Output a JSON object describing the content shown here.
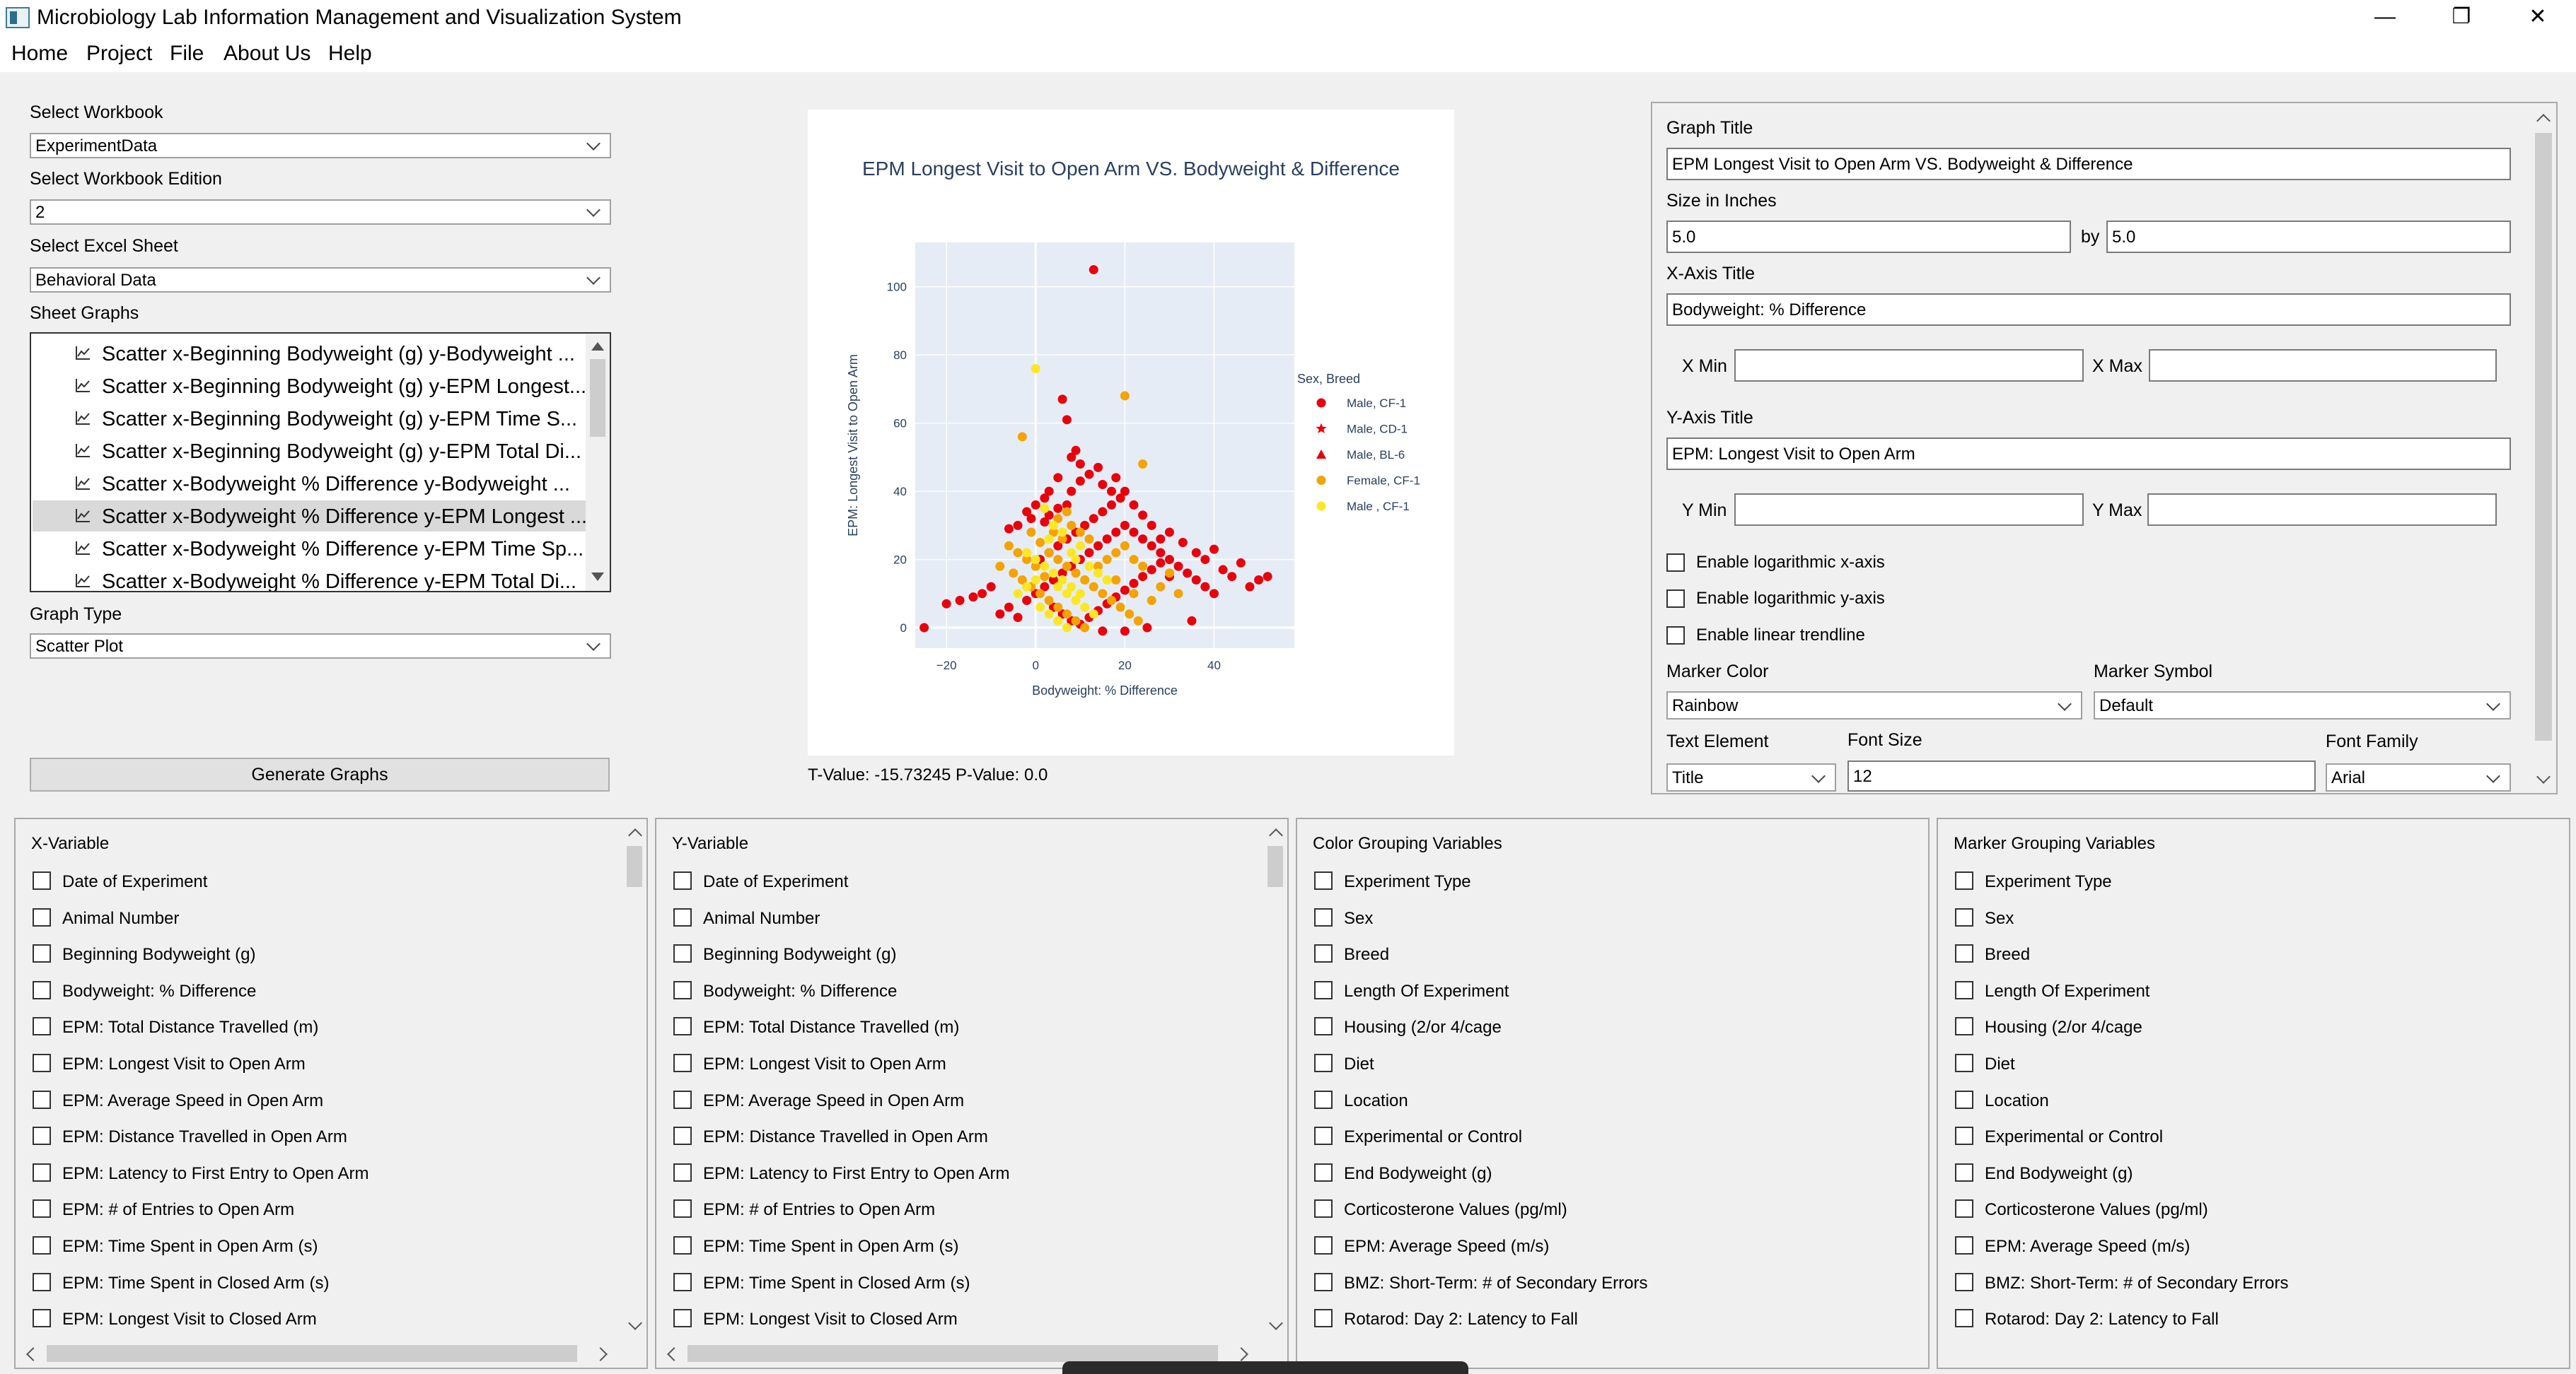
{
  "window": {
    "title": "Microbiology Lab Information Management and Visualization System",
    "minimize": "—",
    "restore": "❐",
    "close": "✕"
  },
  "menu": [
    "Home",
    "Project",
    "File",
    "About Us",
    "Help"
  ],
  "left": {
    "workbook_label": "Select Workbook",
    "workbook_value": "ExperimentData",
    "edition_label": "Select Workbook Edition",
    "edition_value": "2",
    "sheet_label": "Select Excel Sheet",
    "sheet_value": "Behavioral Data",
    "graphs_label": "Sheet Graphs",
    "graphs": [
      "Scatter x-Beginning Bodyweight (g) y-Bodyweight ...",
      "Scatter x-Beginning Bodyweight (g) y-EPM Longest...",
      "Scatter x-Beginning Bodyweight (g) y-EPM Time S...",
      "Scatter x-Beginning Bodyweight (g) y-EPM Total Di...",
      "Scatter x-Bodyweight % Difference y-Bodyweight ...",
      "Scatter x-Bodyweight % Difference y-EPM Longest ...",
      "Scatter x-Bodyweight % Difference y-EPM Time Sp...",
      "Scatter x-Bodyweight % Difference y-EPM Total Di..."
    ],
    "selected_graph_index": 5,
    "graph_type_label": "Graph Type",
    "graph_type_value": "Scatter Plot",
    "generate_button": "Generate Graphs"
  },
  "stats_text": "T-Value: -15.73245  P-Value: 0.0",
  "chart_data": {
    "type": "scatter",
    "title": "EPM Longest Visit to Open Arm VS. Bodyweight & Difference",
    "xlabel": "Bodyweight: % Difference",
    "ylabel": "EPM: Longest Visit to Open Arm",
    "xlim": [
      -27,
      58
    ],
    "ylim": [
      -6,
      113
    ],
    "xticks": [
      -20,
      0,
      20,
      40
    ],
    "xtick_labels": [
      "−20",
      "0",
      "20",
      "40"
    ],
    "yticks": [
      0,
      20,
      40,
      60,
      80,
      100
    ],
    "grid": true,
    "legend_title": "Sex, Breed",
    "legend_position": "right",
    "series": [
      {
        "name": "Male, CF-1",
        "color": "#e8000b",
        "symbol": "circle",
        "points": [
          [
            13,
            105
          ],
          [
            -4,
            30
          ],
          [
            -6,
            29
          ],
          [
            -1,
            32
          ],
          [
            3,
            33
          ],
          [
            2,
            31
          ],
          [
            5,
            35
          ],
          [
            7,
            36
          ],
          [
            8,
            40
          ],
          [
            10,
            43
          ],
          [
            12,
            45
          ],
          [
            14,
            47
          ],
          [
            18,
            44
          ],
          [
            20,
            40
          ],
          [
            22,
            36
          ],
          [
            24,
            33
          ],
          [
            26,
            30
          ],
          [
            28,
            26
          ],
          [
            30,
            28
          ],
          [
            33,
            25
          ],
          [
            36,
            22
          ],
          [
            38,
            20
          ],
          [
            40,
            23
          ],
          [
            42,
            17
          ],
          [
            44,
            15
          ],
          [
            46,
            19
          ],
          [
            48,
            12
          ],
          [
            50,
            14
          ],
          [
            52,
            15
          ],
          [
            -10,
            12
          ],
          [
            -12,
            10
          ],
          [
            -14,
            9
          ],
          [
            -17,
            8
          ],
          [
            -20,
            7
          ],
          [
            -25,
            0
          ],
          [
            -8,
            4
          ],
          [
            -6,
            6
          ],
          [
            -4,
            3
          ],
          [
            -2,
            8
          ],
          [
            0,
            10
          ],
          [
            2,
            12
          ],
          [
            4,
            14
          ],
          [
            6,
            16
          ],
          [
            8,
            18
          ],
          [
            10,
            20
          ],
          [
            12,
            22
          ],
          [
            14,
            24
          ],
          [
            16,
            26
          ],
          [
            18,
            28
          ],
          [
            20,
            30
          ],
          [
            22,
            28
          ],
          [
            24,
            26
          ],
          [
            26,
            24
          ],
          [
            28,
            22
          ],
          [
            30,
            20
          ],
          [
            32,
            18
          ],
          [
            34,
            16
          ],
          [
            36,
            14
          ],
          [
            38,
            12
          ],
          [
            40,
            10
          ],
          [
            4,
            6
          ],
          [
            6,
            4
          ],
          [
            8,
            2
          ],
          [
            10,
            1
          ],
          [
            12,
            3
          ],
          [
            14,
            5
          ],
          [
            16,
            7
          ],
          [
            18,
            9
          ],
          [
            20,
            11
          ],
          [
            22,
            13
          ],
          [
            24,
            15
          ],
          [
            26,
            17
          ],
          [
            28,
            19
          ],
          [
            30,
            15
          ],
          [
            1,
            20
          ],
          [
            3,
            22
          ],
          [
            5,
            24
          ],
          [
            7,
            26
          ],
          [
            9,
            28
          ],
          [
            11,
            30
          ],
          [
            13,
            32
          ],
          [
            15,
            34
          ],
          [
            17,
            36
          ],
          [
            19,
            38
          ],
          [
            6,
            67
          ],
          [
            7,
            61
          ],
          [
            9,
            52
          ],
          [
            8,
            50
          ],
          [
            10,
            48
          ],
          [
            15,
            42
          ],
          [
            17,
            40
          ],
          [
            5,
            44
          ],
          [
            3,
            40
          ],
          [
            2,
            38
          ],
          [
            0,
            36
          ],
          [
            -2,
            34
          ],
          [
            25,
            0
          ],
          [
            35,
            2
          ],
          [
            20,
            -1
          ],
          [
            15,
            -1
          ]
        ]
      },
      {
        "name": "Male, CD-1",
        "color": "#e8000b",
        "symbol": "star",
        "points": []
      },
      {
        "name": "Male, BL-6",
        "color": "#e8000b",
        "symbol": "triangle-up",
        "points": []
      },
      {
        "name": "Female, CF-1",
        "color": "#f5a300",
        "symbol": "circle",
        "points": [
          [
            20,
            68
          ],
          [
            -3,
            56
          ],
          [
            24,
            48
          ],
          [
            -1,
            28
          ],
          [
            1,
            25
          ],
          [
            3,
            22
          ],
          [
            5,
            20
          ],
          [
            7,
            18
          ],
          [
            9,
            16
          ],
          [
            11,
            14
          ],
          [
            13,
            12
          ],
          [
            15,
            10
          ],
          [
            17,
            8
          ],
          [
            19,
            6
          ],
          [
            21,
            4
          ],
          [
            23,
            2
          ],
          [
            -5,
            16
          ],
          [
            -3,
            14
          ],
          [
            -1,
            12
          ],
          [
            1,
            10
          ],
          [
            3,
            8
          ],
          [
            5,
            6
          ],
          [
            7,
            4
          ],
          [
            9,
            2
          ],
          [
            11,
            0
          ],
          [
            14,
            18
          ],
          [
            16,
            20
          ],
          [
            18,
            22
          ],
          [
            20,
            24
          ],
          [
            22,
            20
          ],
          [
            24,
            18
          ],
          [
            12,
            26
          ],
          [
            10,
            28
          ],
          [
            8,
            30
          ],
          [
            6,
            26
          ],
          [
            4,
            28
          ],
          [
            2,
            15
          ],
          [
            0,
            18
          ],
          [
            -2,
            20
          ],
          [
            -4,
            22
          ],
          [
            -6,
            24
          ],
          [
            -8,
            18
          ],
          [
            18,
            14
          ],
          [
            22,
            10
          ],
          [
            26,
            8
          ],
          [
            28,
            12
          ],
          [
            30,
            16
          ],
          [
            32,
            10
          ],
          [
            5,
            32
          ],
          [
            7,
            34
          ]
        ]
      },
      {
        "name": "Male , CF-1",
        "color": "#fde725",
        "symbol": "circle",
        "points": [
          [
            0,
            76
          ],
          [
            2,
            35
          ],
          [
            4,
            30
          ],
          [
            6,
            28
          ],
          [
            -2,
            22
          ],
          [
            0,
            20
          ],
          [
            2,
            18
          ],
          [
            4,
            16
          ],
          [
            6,
            14
          ],
          [
            8,
            12
          ],
          [
            10,
            10
          ],
          [
            1,
            6
          ],
          [
            3,
            4
          ],
          [
            5,
            2
          ],
          [
            7,
            0
          ],
          [
            9,
            8
          ],
          [
            11,
            6
          ],
          [
            13,
            4
          ],
          [
            -4,
            10
          ],
          [
            -2,
            12
          ],
          [
            0,
            14
          ],
          [
            12,
            18
          ],
          [
            14,
            16
          ],
          [
            16,
            14
          ],
          [
            8,
            22
          ],
          [
            10,
            24
          ],
          [
            3,
            26
          ],
          [
            5,
            12
          ],
          [
            7,
            10
          ],
          [
            9,
            20
          ]
        ]
      }
    ]
  },
  "settings": {
    "graph_title_label": "Graph Title",
    "graph_title_value": "EPM Longest Visit to Open Arm VS. Bodyweight & Difference",
    "size_label": "Size in Inches",
    "size_w": "5.0",
    "size_by": "by",
    "size_h": "5.0",
    "xaxis_label": "X-Axis Title",
    "xaxis_value": "Bodyweight: % Difference",
    "xmin_label": "X Min",
    "xmax_label": "X Max",
    "xmin_value": "",
    "xmax_value": "",
    "yaxis_label": "Y-Axis Title",
    "yaxis_value": "EPM: Longest Visit to Open Arm",
    "ymin_label": "Y Min",
    "ymax_label": "Y Max",
    "ymin_value": "",
    "ymax_value": "",
    "log_x": "Enable logarithmic x-axis",
    "log_y": "Enable logarithmic y-axis",
    "trendline": "Enable linear trendline",
    "marker_color_label": "Marker Color",
    "marker_color_value": "Rainbow",
    "marker_symbol_label": "Marker Symbol",
    "marker_symbol_value": "Default",
    "text_element_label": "Text Element",
    "text_element_value": "Title",
    "font_size_label": "Font Size",
    "font_size_value": "12",
    "font_family_label": "Font Family",
    "font_family_value": "Arial"
  },
  "panels": {
    "x_title": "X-Variable",
    "y_title": "Y-Variable",
    "color_title": "Color Grouping Variables",
    "marker_title": "Marker Grouping Variables",
    "xy_vars": [
      "Date of Experiment",
      "Animal Number",
      "Beginning Bodyweight (g)",
      "Bodyweight: % Difference",
      "EPM: Total Distance Travelled (m)",
      "EPM: Longest Visit to Open Arm",
      "EPM: Average Speed in Open Arm",
      "EPM: Distance Travelled in Open Arm",
      "EPM: Latency to First Entry to Open Arm",
      "EPM: # of Entries to Open Arm",
      "EPM: Time Spent in Open Arm (s)",
      "EPM: Time Spent in Closed Arm (s)",
      "EPM: Longest Visit to Closed Arm"
    ],
    "group_vars": [
      "Experiment Type",
      "Sex",
      "Breed",
      "Length Of Experiment",
      "Housing (2/or 4/cage",
      "Diet",
      "Location",
      "Experimental or Control",
      "End Bodyweight (g)",
      "Corticosterone Values (pg/ml)",
      "EPM: Average Speed (m/s)",
      "BMZ: Short-Term:     # of Secondary Errors",
      "Rotarod: Day 2: Latency to Fall"
    ]
  }
}
